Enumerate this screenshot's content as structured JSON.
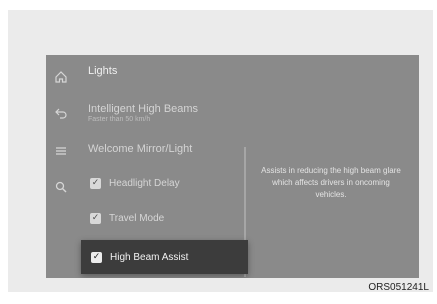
{
  "screen": {
    "title": "Lights",
    "rail": {
      "icons": [
        "home-icon",
        "back-icon",
        "menu-icon",
        "search-icon"
      ]
    },
    "items": {
      "high_beams": {
        "label": "Intelligent High Beams",
        "sublabel": "Faster than 50 km/h"
      },
      "welcome": {
        "label": "Welcome Mirror/Light"
      },
      "headlight_delay": {
        "label": "Headlight Delay",
        "checked": true
      },
      "travel_mode": {
        "label": "Travel Mode",
        "checked": true
      },
      "high_beam_assist": {
        "label": "High Beam Assist",
        "checked": true
      }
    },
    "description": "Assists in reducing the high beam glare which affects drivers in oncoming vehicles."
  },
  "caption": "ORS051241L",
  "colors": {
    "screen_bg": "#8a8a8a",
    "selected_bg": "#3c3c3c"
  }
}
